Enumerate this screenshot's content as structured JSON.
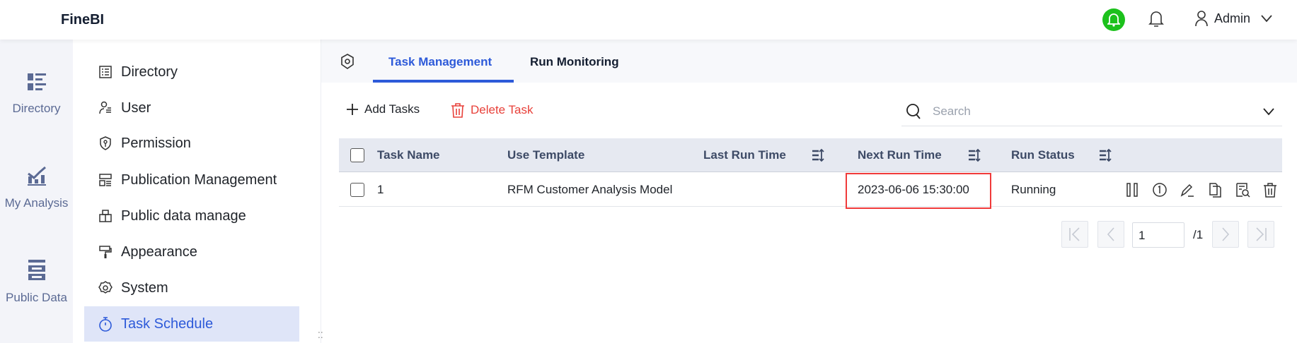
{
  "header": {
    "app_title": "FineBI",
    "user_name": "Admin"
  },
  "rail": {
    "items": [
      {
        "label": "Directory"
      },
      {
        "label": "My Analysis"
      },
      {
        "label": "Public Data"
      }
    ]
  },
  "sidebar": {
    "items": [
      {
        "label": "Directory"
      },
      {
        "label": "User"
      },
      {
        "label": "Permission"
      },
      {
        "label": "Publication Management"
      },
      {
        "label": "Public data manage"
      },
      {
        "label": "Appearance"
      },
      {
        "label": "System"
      },
      {
        "label": "Task Schedule"
      }
    ]
  },
  "tabs": [
    {
      "label": "Task Management",
      "active": true
    },
    {
      "label": "Run Monitoring",
      "active": false
    }
  ],
  "toolbar": {
    "add_label": "Add Tasks",
    "delete_label": "Delete Task",
    "search_placeholder": "Search"
  },
  "table": {
    "columns": [
      "Task Name",
      "Use Template",
      "Last Run Time",
      "Next Run Time",
      "Run Status"
    ],
    "rows": [
      {
        "task_name": "1",
        "template": "RFM Customer Analysis Model",
        "last_run": "",
        "next_run": "2023-06-06 15:30:00",
        "status": "Running"
      }
    ]
  },
  "pagination": {
    "current": "1",
    "total": "/1"
  },
  "colors": {
    "accent": "#2d5ad9",
    "danger": "#e8413a",
    "highlight": "#f03a3a",
    "notify": "#1cc11c"
  }
}
